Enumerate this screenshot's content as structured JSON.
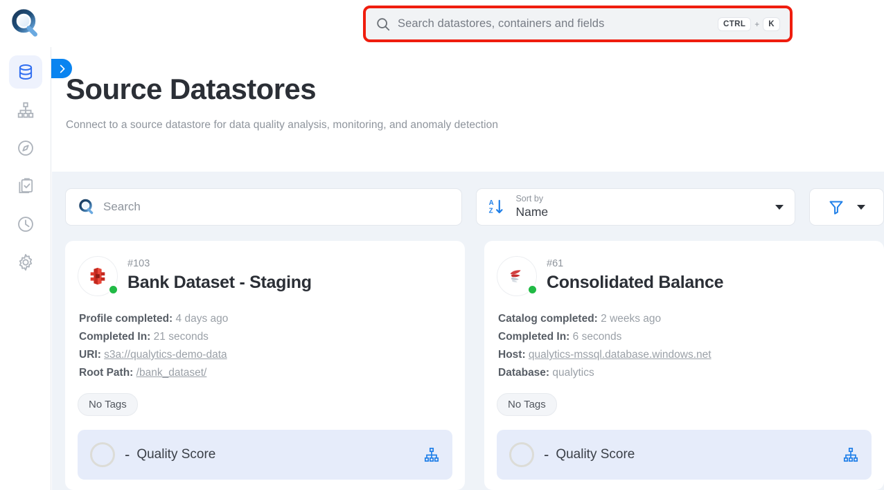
{
  "app": {
    "logo_icon": "qualytics-magnifier-logo"
  },
  "global_search": {
    "icon": "search-icon",
    "placeholder": "Search datastores, containers and fields",
    "shortcut_key_1": "CTRL",
    "shortcut_plus": "+",
    "shortcut_key_2": "K",
    "highlight_color": "#ef1d0e"
  },
  "sidebar": {
    "expand_icon": "chevron-right-icon",
    "items": [
      {
        "name": "datastores",
        "icon": "database-icon",
        "active": true
      },
      {
        "name": "containers",
        "icon": "hierarchy-icon",
        "active": false
      },
      {
        "name": "explore",
        "icon": "compass-icon",
        "active": false
      },
      {
        "name": "tasks",
        "icon": "clipboard-check-icon",
        "active": false
      },
      {
        "name": "history",
        "icon": "clock-icon",
        "active": false
      },
      {
        "name": "settings",
        "icon": "gear-icon",
        "active": false
      }
    ]
  },
  "header": {
    "title": "Source Datastores",
    "subtitle": "Connect to a source datastore for data quality analysis, monitoring, and anomaly detection"
  },
  "toolbar": {
    "search": {
      "icon": "search-icon",
      "placeholder": "Search",
      "value": ""
    },
    "sort": {
      "icon": "sort-alpha-down-icon",
      "label": "Sort by",
      "value": "Name",
      "caret": "chevron-down-icon"
    },
    "filter": {
      "icon": "filter-funnel-icon",
      "caret": "chevron-down-icon"
    }
  },
  "cards": [
    {
      "id": "#103",
      "name": "Bank Dataset - Staging",
      "icon": "aws-s3-icon",
      "status": "online",
      "status_color": "#21ba45",
      "meta": [
        {
          "label": "Profile completed:",
          "value": "4 days ago",
          "link": false
        },
        {
          "label": "Completed In:",
          "value": "21 seconds",
          "link": false
        },
        {
          "label": "URI:",
          "value": "s3a://qualytics-demo-data",
          "link": true
        },
        {
          "label": "Root Path:",
          "value": "/bank_dataset/",
          "link": true
        }
      ],
      "tag": "No Tags",
      "score": {
        "value": "-",
        "label": "Quality Score",
        "icon": "hierarchy-icon"
      }
    },
    {
      "id": "#61",
      "name": "Consolidated Balance",
      "icon": "mssql-icon",
      "status": "online",
      "status_color": "#21ba45",
      "meta": [
        {
          "label": "Catalog completed:",
          "value": "2 weeks ago",
          "link": false
        },
        {
          "label": "Completed In:",
          "value": "6 seconds",
          "link": false
        },
        {
          "label": "Host:",
          "value": "qualytics-mssql.database.windows.net",
          "link": true
        },
        {
          "label": "Database:",
          "value": "qualytics",
          "link": false
        }
      ],
      "tag": "No Tags",
      "score": {
        "value": "-",
        "label": "Quality Score",
        "icon": "hierarchy-icon"
      }
    }
  ],
  "colors": {
    "accent_blue": "#0a84f0",
    "page_background": "#eff3f8",
    "score_background": "#e6ecfa"
  }
}
